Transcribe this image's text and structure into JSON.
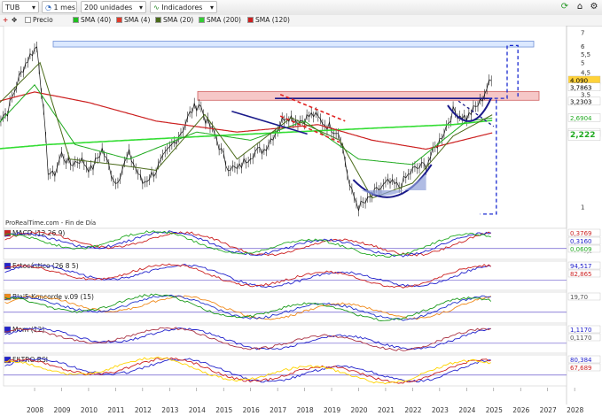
{
  "toolbar": {
    "ticker": "TUB",
    "period": "1 mes",
    "units": "200 unidades",
    "indicators": "Indicadores"
  },
  "legend": {
    "price": "Precio",
    "sma": [
      "SMA (40)",
      "SMA (4)",
      "SMA (20)",
      "SMA (200)",
      "SMA (120)"
    ],
    "sma_colors": [
      "#1fbf1f",
      "#e03a2a",
      "#4a6a1a",
      "#33cc33",
      "#cc2020"
    ]
  },
  "chart_data": [
    {
      "type": "line",
      "title": "",
      "source": "ProRealTime.com - Fin de Día",
      "x_ticks": [
        "2008",
        "2009",
        "2010",
        "2011",
        "2012",
        "2013",
        "2014",
        "2015",
        "2016",
        "2017",
        "2018",
        "2019",
        "2020",
        "2021",
        "2022",
        "2023",
        "2024",
        "2025",
        "2026",
        "2027",
        "2028"
      ],
      "y_ticks": [
        "7",
        "6",
        "5,5",
        "5",
        "4,5",
        "3,5",
        "1"
      ],
      "ylim": [
        0.8,
        7.4
      ],
      "y_scale": "log",
      "price": {
        "x": [
          2007.0,
          2007.5,
          2007.8,
          2008.1,
          2008.4,
          2008.6,
          2008.8,
          2009.0,
          2009.2,
          2009.5,
          2009.8,
          2010.2,
          2010.6,
          2011.0,
          2011.5,
          2012.0,
          2012.5,
          2013.0,
          2013.5,
          2014.0,
          2014.3,
          2014.6,
          2014.8,
          2015.2,
          2015.6,
          2016.0,
          2016.5,
          2017.0,
          2017.5,
          2017.8,
          2018.3,
          2018.8,
          2019.3,
          2019.8,
          2020.2,
          2020.5,
          2020.8,
          2021.2,
          2021.6,
          2022.0,
          2022.5,
          2023.0,
          2023.5,
          2024.0,
          2024.5,
          2025.0,
          2025.3,
          2025.45
        ],
        "values": [
          2.5,
          2.9,
          3.8,
          4.8,
          5.6,
          6.0,
          3.2,
          1.5,
          1.4,
          1.8,
          1.6,
          1.7,
          1.5,
          1.9,
          1.3,
          1.8,
          1.3,
          1.5,
          1.9,
          2.4,
          2.9,
          3.2,
          2.7,
          2.2,
          1.6,
          1.5,
          1.8,
          1.9,
          2.4,
          2.8,
          2.6,
          2.8,
          2.5,
          2.3,
          1.2,
          1.0,
          1.05,
          1.2,
          1.3,
          1.25,
          1.5,
          1.6,
          2.1,
          2.9,
          2.7,
          3.2,
          3.9,
          4.09
        ]
      },
      "sma_200": {
        "x": [
          2007.0,
          2009.0,
          2012.0,
          2015.0,
          2018.0,
          2021.0,
          2024.0,
          2025.45
        ],
        "values": [
          1.9,
          2.0,
          2.1,
          2.2,
          2.3,
          2.4,
          2.5,
          2.62
        ]
      },
      "sma_120": {
        "x": [
          2007.0,
          2008.5,
          2010.5,
          2013.0,
          2016.0,
          2019.0,
          2021.0,
          2023.0,
          2025.45
        ],
        "values": [
          3.2,
          3.6,
          3.2,
          2.6,
          2.3,
          2.5,
          2.1,
          1.9,
          2.28
        ]
      },
      "sma_40": {
        "x": [
          2007.0,
          2008.5,
          2010.0,
          2012.0,
          2014.5,
          2016.5,
          2018.5,
          2020.5,
          2022.5,
          2024.5,
          2025.45
        ],
        "values": [
          2.4,
          3.9,
          2.0,
          1.7,
          2.3,
          2.1,
          2.6,
          1.7,
          1.6,
          2.6,
          2.69
        ]
      },
      "sma_20": {
        "x": [
          2007.0,
          2008.7,
          2009.8,
          2011.5,
          2013.0,
          2014.8,
          2016.0,
          2018.0,
          2019.8,
          2021.0,
          2022.5,
          2024.0,
          2025.45
        ],
        "values": [
          3.0,
          5.0,
          1.7,
          1.6,
          1.5,
          2.8,
          1.7,
          2.7,
          2.1,
          1.1,
          1.3,
          2.2,
          2.79
        ]
      },
      "right_labels": [
        "4,090",
        "3,7863",
        "3,2303",
        "2,6904",
        "2,2790",
        "2,222"
      ],
      "right_label_values": [
        4.09,
        3.7863,
        3.2303,
        2.6904,
        2.279,
        2.222
      ],
      "right_label_colors": [
        "#ffd23a",
        "#ffffff",
        "#ffffff",
        "#ffffff",
        "#ffffff",
        "#ffffff"
      ],
      "right_label_text_colors": [
        "#000000",
        "#000000",
        "#000000",
        "#22aa22",
        "#555555",
        "#22aa22"
      ]
    },
    {
      "type": "line",
      "title": "MACD (12 26 9)",
      "y_ticks": [
        "-0,5"
      ],
      "right_labels": [
        "0,3769",
        "0,3160",
        "0,0609"
      ],
      "right_label_text_colors": [
        "#cc2222",
        "#2222cc",
        "#22aa22"
      ]
    },
    {
      "type": "line",
      "title": "Estocástico (26 8 5)",
      "right_labels": [
        "94,517",
        "82,865"
      ],
      "right_label_text_colors": [
        "#2222cc",
        "#cc2222"
      ]
    },
    {
      "type": "area",
      "title": "Blai5 Koncorde v.09 (15)",
      "right_labels": [
        "19,70"
      ],
      "right_label_text_colors": [
        "#555555"
      ]
    },
    {
      "type": "area",
      "title": "Mom (12)",
      "right_labels": [
        "1,1170",
        "0,1170"
      ],
      "right_label_text_colors": [
        "#2222cc",
        "#555555"
      ]
    },
    {
      "type": "line",
      "title": "FILTRO RSI",
      "right_labels": [
        "80,384",
        "67,689"
      ],
      "right_label_text_colors": [
        "#2222cc",
        "#cc2222"
      ]
    }
  ]
}
